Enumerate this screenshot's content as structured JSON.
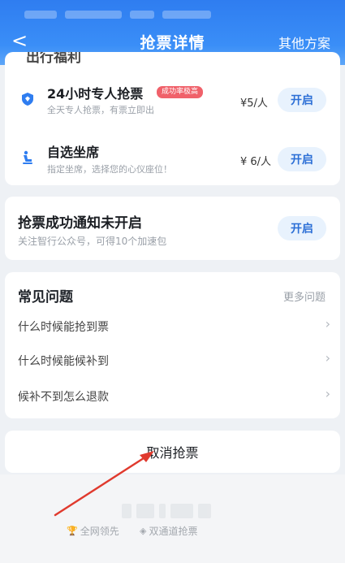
{
  "header": {
    "back_glyph": "<",
    "title": "抢票详情",
    "other_label": "其他方案"
  },
  "services": {
    "partial_heading": "出行福利",
    "items": [
      {
        "name": "24小时专人抢票",
        "badge": "成功率极高",
        "desc": "全天专人抢票，有票立即出",
        "price": "¥5/人",
        "button": "开启",
        "icon": "diamond-shield-icon"
      },
      {
        "name": "自选坐席",
        "desc": "指定坐席，选择您的心仪座位！",
        "price": "¥ 6/人",
        "button": "开启",
        "icon": "seat-icon"
      }
    ]
  },
  "notify": {
    "title": "抢票成功通知未开启",
    "desc": "关注智行公众号，可得10个加速包",
    "button": "开启"
  },
  "faq": {
    "title": "常见问题",
    "more": "更多问题",
    "items": [
      {
        "label": "什么时候能抢到票"
      },
      {
        "label": "什么时候能候补到"
      },
      {
        "label": "候补不到怎么退款"
      }
    ]
  },
  "cancel": {
    "label": "取消抢票"
  },
  "footer": {
    "features": [
      {
        "label": "全网领先",
        "icon": "trophy-icon"
      },
      {
        "label": "双通道抢票",
        "icon": "dual-channel-icon"
      }
    ]
  },
  "colors": {
    "header": "#3a8ef7",
    "button_bg": "#e8f2fd",
    "button_text": "#2c6fd6",
    "badge": "#f0616a",
    "annotation_arrow": "#e03a2e"
  }
}
